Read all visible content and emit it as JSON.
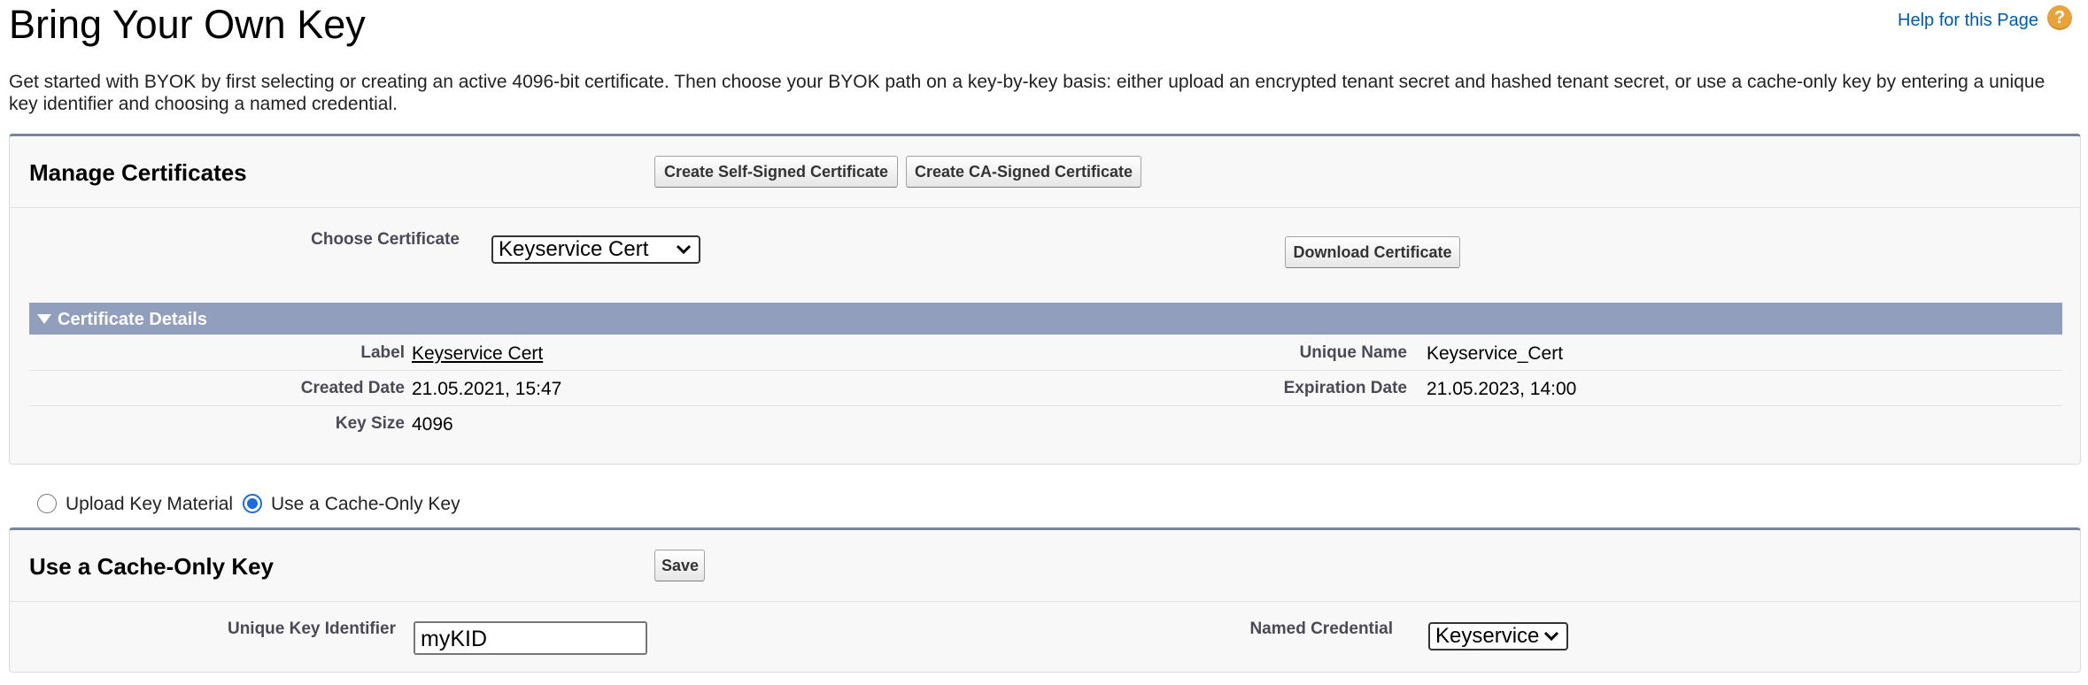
{
  "page": {
    "title": "Bring Your Own Key",
    "help_link": "Help for this Page",
    "help_icon": "?",
    "intro": "Get started with BYOK by first selecting or creating an active 4096-bit certificate. Then choose your BYOK path on a key-by-key basis: either upload an encrypted tenant secret and hashed tenant secret, or use a cache-only key by entering a unique key identifier and choosing a named credential."
  },
  "manage_certificates": {
    "title": "Manage Certificates",
    "create_self_signed_label": "Create Self-Signed Certificate",
    "create_ca_signed_label": "Create CA-Signed Certificate",
    "choose_certificate_label": "Choose Certificate",
    "choose_certificate_value": "Keyservice Cert",
    "download_label": "Download Certificate",
    "details": {
      "title": "Certificate Details",
      "label_label": "Label",
      "label_value": "Keyservice Cert",
      "unique_name_label": "Unique Name",
      "unique_name_value": "Keyservice_Cert",
      "created_date_label": "Created Date",
      "created_date_value": "21.05.2021, 15:47",
      "expiration_date_label": "Expiration Date",
      "expiration_date_value": "21.05.2023, 14:00",
      "key_size_label": "Key Size",
      "key_size_value": "4096"
    }
  },
  "key_path": {
    "options": [
      {
        "label": "Upload Key Material",
        "selected": false
      },
      {
        "label": "Use a Cache-Only Key",
        "selected": true
      }
    ]
  },
  "cache_only_key": {
    "title": "Use a Cache-Only Key",
    "save_label": "Save",
    "unique_key_identifier_label": "Unique Key Identifier",
    "unique_key_identifier_value": "myKID",
    "named_credential_label": "Named Credential",
    "named_credential_value": "Keyservice"
  },
  "colors": {
    "accent_bar": "#919fbd",
    "help_icon": "#e8a33a",
    "link": "#015ba7",
    "radio_selected": "#1a6cd9"
  }
}
